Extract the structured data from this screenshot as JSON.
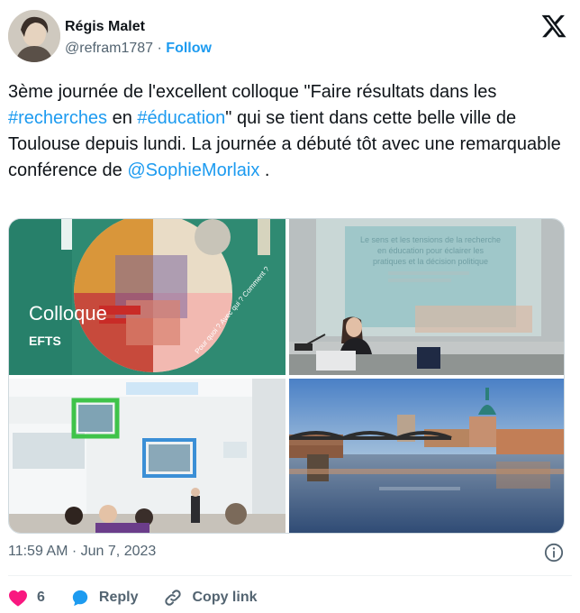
{
  "author": {
    "name": "Régis Malet",
    "handle": "@refram1787",
    "separator": "·",
    "follow_label": "Follow"
  },
  "tweet": {
    "seg1": "3ème journée de l'excellent colloque \"Faire résultats dans les ",
    "hashtag1": "#recherches",
    "seg2": " en ",
    "hashtag2": "#éducation",
    "seg3": "\" qui se tient dans cette belle ville de Toulouse depuis lundi. La journée a débuté tôt avec une remarquable conférence de ",
    "mention": "@SophieMorlaix",
    "seg4": " ."
  },
  "media": {
    "poster": {
      "colloque_label": "Colloque",
      "efts_label": "EFTS",
      "question_text": "Pour quoi ? Avec qui ? Comment ?"
    },
    "slide": {
      "line1": "Le sens et les tensions de la recherche",
      "line2": "en éducation pour éclairer les",
      "line3": "pratiques et la décision politique"
    }
  },
  "meta": {
    "time": "11:59 AM",
    "separator": "·",
    "date": "Jun 7, 2023"
  },
  "actions": {
    "like_count": "6",
    "reply_label": "Reply",
    "copy_label": "Copy link"
  },
  "colors": {
    "accent": "#1d9bf0",
    "like": "#f91880",
    "text_secondary": "#536471"
  },
  "icons": [
    "x-logo-icon",
    "info-icon",
    "heart-icon",
    "reply-icon",
    "link-icon"
  ]
}
